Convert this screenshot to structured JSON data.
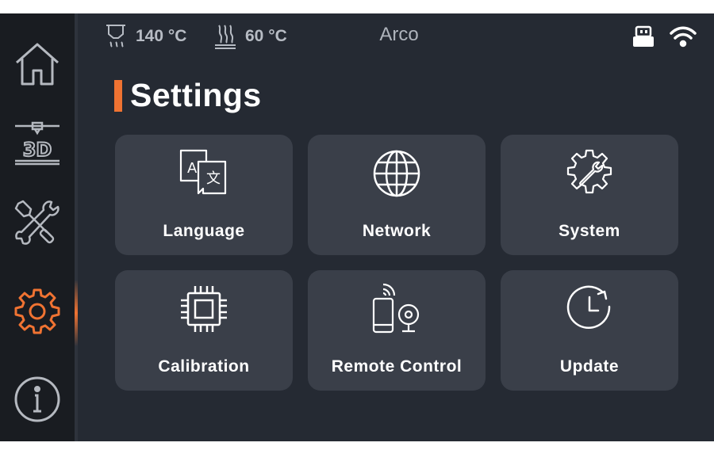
{
  "status_bar": {
    "nozzle_temp": "140 °C",
    "bed_temp": "60 °C",
    "printer_name": "Arco"
  },
  "sidebar": {
    "items": [
      {
        "name": "home",
        "icon": "home-icon"
      },
      {
        "name": "print",
        "icon": "3d-printer-icon"
      },
      {
        "name": "tools",
        "icon": "wrench-screwdriver-icon"
      },
      {
        "name": "settings",
        "icon": "gear-icon",
        "active": true
      },
      {
        "name": "info",
        "icon": "info-icon"
      }
    ]
  },
  "page": {
    "title": "Settings"
  },
  "tiles": [
    {
      "label": "Language",
      "icon": "language-translate-icon"
    },
    {
      "label": "Network",
      "icon": "globe-icon"
    },
    {
      "label": "System",
      "icon": "gear-wrench-icon"
    },
    {
      "label": "Calibration",
      "icon": "chip-icon"
    },
    {
      "label": "Remote Control",
      "icon": "phone-camera-icon"
    },
    {
      "label": "Update",
      "icon": "clock-refresh-icon"
    }
  ],
  "colors": {
    "accent": "#f07332",
    "background": "#252a33",
    "sidebar": "#191c21",
    "tile": "#3a3f49"
  }
}
